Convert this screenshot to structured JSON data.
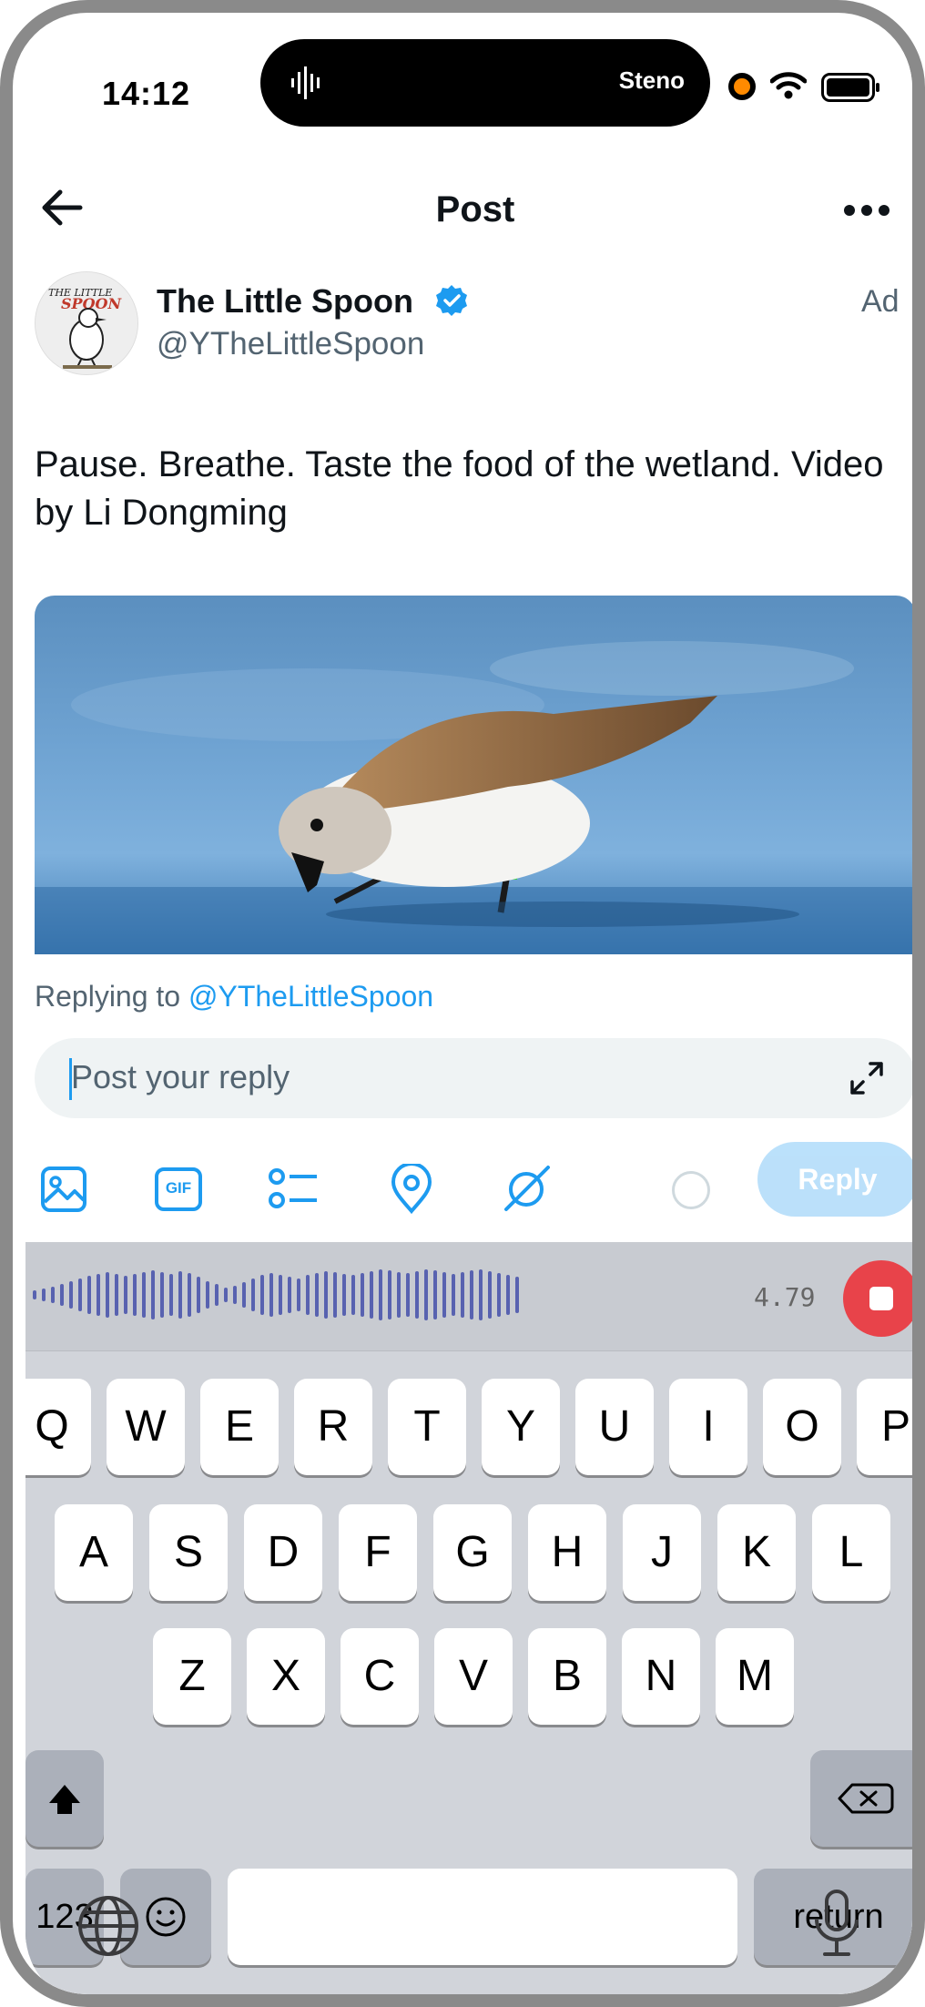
{
  "status_bar": {
    "time": "14:12",
    "island_app": "Steno",
    "recording_dot_color": "#ff8a00"
  },
  "header": {
    "title": "Post",
    "back_icon": "arrow-left-icon",
    "more_icon": "more-dots-icon"
  },
  "post": {
    "author_name": "The Little Spoon",
    "author_handle": "@YTheLittleSpoon",
    "ad_label": "Ad",
    "avatar_text": "THE LITTLE SPOON",
    "text": "Pause. Breathe. Taste the food of the wetland. Video by Li Dongming",
    "media_alt": "Sandpiper bird feeding at water's edge"
  },
  "reply": {
    "replying_prefix": "Replying to",
    "replying_handle": "@YTheLittleSpoon",
    "placeholder": "Post your reply",
    "button_label": "Reply",
    "tools": [
      "image-icon",
      "gif-icon",
      "poll-icon",
      "location-icon",
      "grok-icon"
    ],
    "gif_label": "GIF",
    "accent_color": "#1d9bf0"
  },
  "dictation": {
    "elapsed": "4.79",
    "stop_color": "#e8434a"
  },
  "keyboard": {
    "row1": [
      "Q",
      "W",
      "E",
      "R",
      "T",
      "Y",
      "U",
      "I",
      "O",
      "P"
    ],
    "row2": [
      "A",
      "S",
      "D",
      "F",
      "G",
      "H",
      "J",
      "K",
      "L"
    ],
    "row3": [
      "Z",
      "X",
      "C",
      "V",
      "B",
      "N",
      "M"
    ],
    "numbers_label": "123",
    "return_label": "return"
  }
}
